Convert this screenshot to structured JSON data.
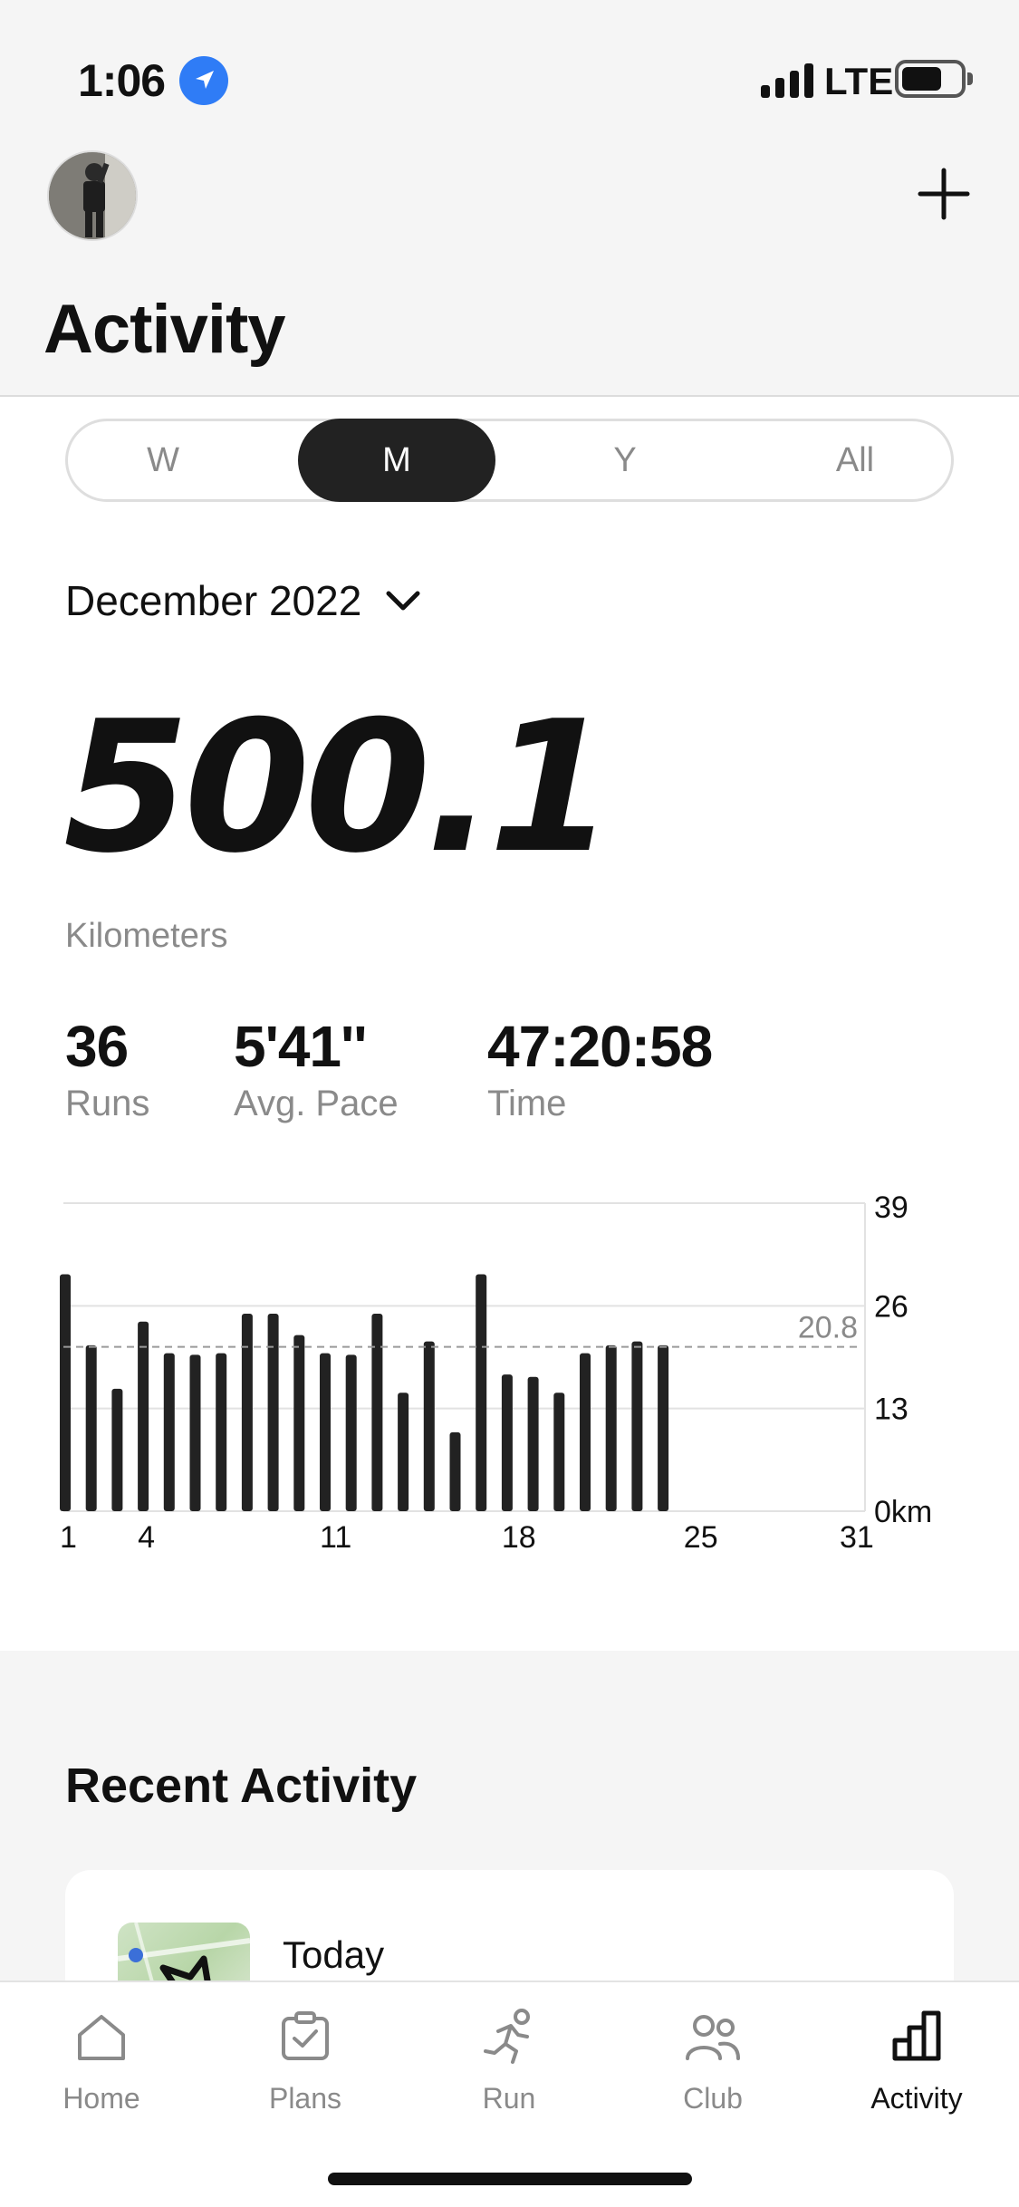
{
  "status_bar": {
    "time": "1:06",
    "network": "LTE"
  },
  "header": {
    "title": "Activity"
  },
  "segments": {
    "items": [
      "W",
      "M",
      "Y",
      "All"
    ],
    "selected": "M"
  },
  "period": {
    "label": "December 2022"
  },
  "summary": {
    "distance": "500.1",
    "unit": "Kilometers",
    "stats": [
      {
        "value": "36",
        "label": "Runs"
      },
      {
        "value": "5'41''",
        "label": "Avg. Pace"
      },
      {
        "value": "47:20:58",
        "label": "Time"
      }
    ]
  },
  "chart_data": {
    "type": "bar",
    "x": [
      1,
      2,
      3,
      4,
      5,
      6,
      7,
      8,
      9,
      10,
      11,
      12,
      13,
      14,
      15,
      16,
      17,
      18,
      19,
      20,
      21,
      22,
      23,
      24
    ],
    "values": [
      30,
      21,
      15.5,
      24,
      20,
      19.8,
      20,
      25,
      25,
      22.3,
      20,
      19.8,
      25,
      15,
      21.5,
      10,
      30,
      17.3,
      17,
      15,
      20,
      21,
      21.5,
      21
    ],
    "x_ticks": [
      "1",
      "4",
      "11",
      "18",
      "25",
      "31"
    ],
    "x_tick_values": [
      1,
      4,
      11,
      18,
      25,
      31
    ],
    "xlim": [
      1,
      31
    ],
    "y_ticks": [
      "39",
      "26",
      "13",
      "0km"
    ],
    "y_tick_values": [
      39,
      26,
      13,
      0
    ],
    "ylim": [
      0,
      39
    ],
    "average": 20.8,
    "average_label": "20.8",
    "grid": true,
    "bar_color": "#222222"
  },
  "recent": {
    "title": "Recent Activity",
    "items": [
      {
        "date": "Today"
      }
    ]
  },
  "tabbar": {
    "items": [
      {
        "label": "Home",
        "icon": "home-icon"
      },
      {
        "label": "Plans",
        "icon": "plans-icon"
      },
      {
        "label": "Run",
        "icon": "run-icon"
      },
      {
        "label": "Club",
        "icon": "club-icon"
      },
      {
        "label": "Activity",
        "icon": "activity-icon"
      }
    ],
    "active": "Activity"
  },
  "colors": {
    "accent": "#2f7cf6",
    "text": "#111111",
    "muted": "#8a8a8a",
    "background_gray": "#f5f5f5"
  }
}
